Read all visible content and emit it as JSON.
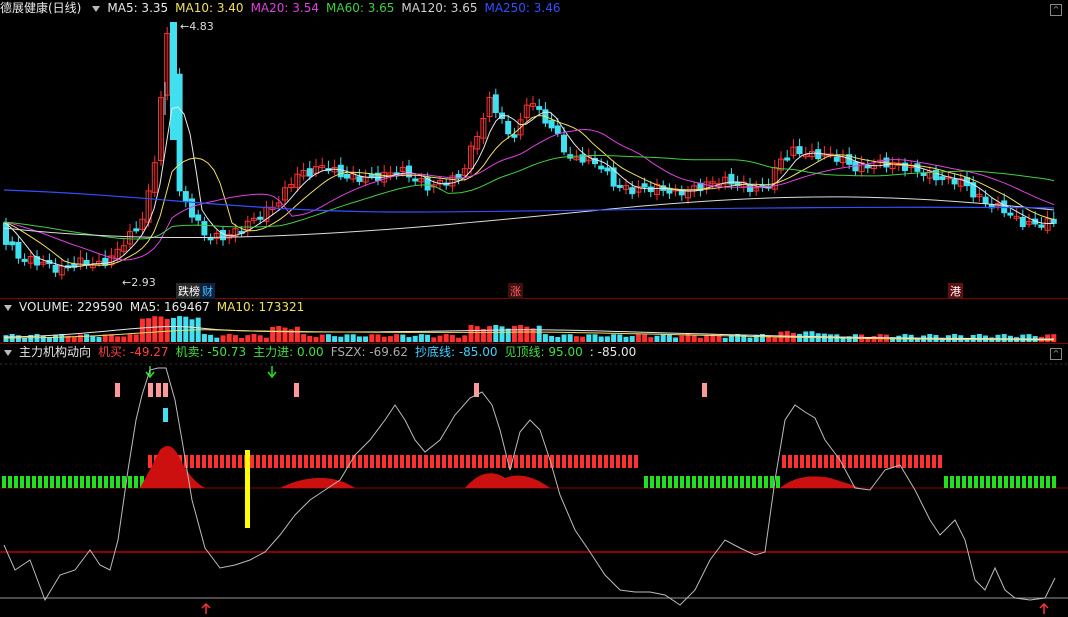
{
  "main_header": {
    "title": "德展健康(日线)",
    "items": [
      {
        "label": "MA5: 3.35",
        "color": "#e8e8e8"
      },
      {
        "label": "MA10: 3.40",
        "color": "#f0e060"
      },
      {
        "label": "MA20: 3.54",
        "color": "#e040e0"
      },
      {
        "label": "MA60: 3.65",
        "color": "#40d040"
      },
      {
        "label": "MA120: 3.65",
        "color": "#d0d0d0"
      },
      {
        "label": "MA250: 3.46",
        "color": "#3050ff"
      }
    ]
  },
  "price_annotations": {
    "high": "4.83",
    "low": "2.93"
  },
  "markers": [
    {
      "text": "跌榜",
      "color": "#ffffff",
      "bg": "#2a2a2a"
    },
    {
      "text": "财",
      "color": "#40c8ff",
      "bg": "#102040"
    },
    {
      "text": "涨",
      "color": "#ff6060",
      "bg": "#401010"
    },
    {
      "text": "港",
      "color": "#ffffff",
      "bg": "#601010"
    }
  ],
  "volume_header": {
    "title": "VOLUME: 229590",
    "items": [
      {
        "label": "MA5: 169467",
        "color": "#e8e8e8"
      },
      {
        "label": "MA10: 173321",
        "color": "#f0e060"
      }
    ]
  },
  "indicator_header": {
    "title": "主力机构动向",
    "items": [
      {
        "label": "机买: -49.27",
        "color": "#ff4040"
      },
      {
        "label": "机卖: -50.73",
        "color": "#40e040"
      },
      {
        "label": "主力进: 0.00",
        "color": "#40e040"
      },
      {
        "label": "FSZX: -69.62",
        "color": "#aaaaaa"
      },
      {
        "label": "抄底线: -85.00",
        "color": "#40d0ff"
      },
      {
        "label": "见顶线: 95.00",
        "color": "#40e040"
      },
      {
        "label": ": -85.00",
        "color": "#e8e8e8"
      }
    ]
  },
  "colors": {
    "up": "#ff3030",
    "down": "#40e0f0",
    "grid": "#8a0000"
  }
}
